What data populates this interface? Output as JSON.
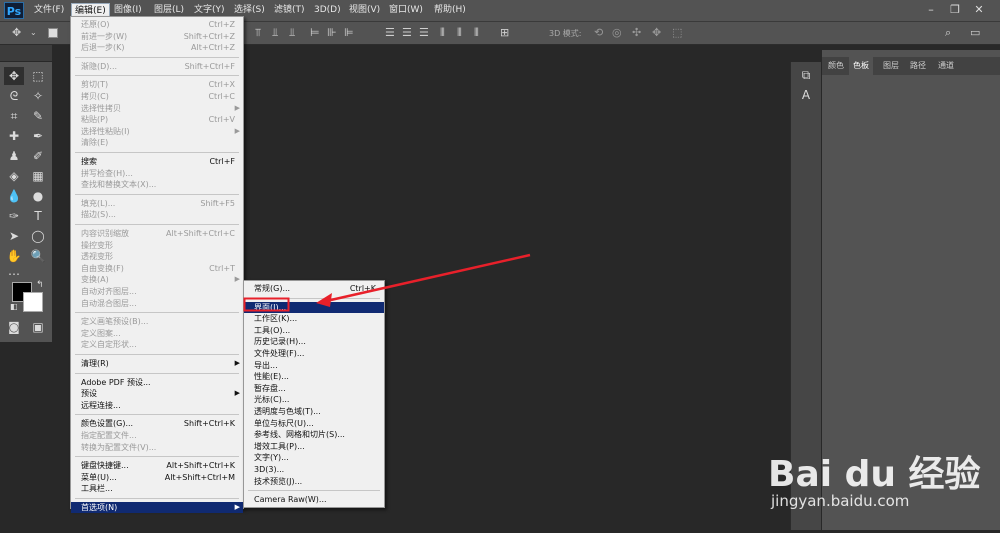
{
  "app": {
    "logo": "Ps"
  },
  "menubar": {
    "items": [
      "文件(F)",
      "编辑(E)",
      "图像(I)",
      "图层(L)",
      "文字(Y)",
      "选择(S)",
      "滤镜(T)",
      "3D(D)",
      "视图(V)",
      "窗口(W)",
      "帮助(H)"
    ],
    "active_index": 1
  },
  "options_bar": {
    "mode_label": "3D 模式:"
  },
  "panels": {
    "tabs": [
      "颜色",
      "色板",
      "图层",
      "路径",
      "通道"
    ],
    "active_tab": "色板"
  },
  "edit_menu": {
    "groups": [
      [
        {
          "label": "还原(O)",
          "shortcut": "Ctrl+Z",
          "disabled": true
        },
        {
          "label": "前进一步(W)",
          "shortcut": "Shift+Ctrl+Z",
          "disabled": true
        },
        {
          "label": "后退一步(K)",
          "shortcut": "Alt+Ctrl+Z",
          "disabled": true
        }
      ],
      [
        {
          "label": "渐隐(D)...",
          "shortcut": "Shift+Ctrl+F",
          "disabled": true
        }
      ],
      [
        {
          "label": "剪切(T)",
          "shortcut": "Ctrl+X",
          "disabled": true
        },
        {
          "label": "拷贝(C)",
          "shortcut": "Ctrl+C",
          "disabled": true
        },
        {
          "label": "选择性拷贝",
          "shortcut": "",
          "disabled": true,
          "submenu": true
        },
        {
          "label": "粘贴(P)",
          "shortcut": "Ctrl+V",
          "disabled": true
        },
        {
          "label": "选择性粘贴(I)",
          "shortcut": "",
          "disabled": true,
          "submenu": true
        },
        {
          "label": "清除(E)",
          "shortcut": "",
          "disabled": true
        }
      ],
      [
        {
          "label": "搜索",
          "shortcut": "Ctrl+F",
          "disabled": false
        },
        {
          "label": "拼写检查(H)...",
          "shortcut": "",
          "disabled": true
        },
        {
          "label": "查找和替换文本(X)...",
          "shortcut": "",
          "disabled": true
        }
      ],
      [
        {
          "label": "填充(L)...",
          "shortcut": "Shift+F5",
          "disabled": true
        },
        {
          "label": "描边(S)...",
          "shortcut": "",
          "disabled": true
        }
      ],
      [
        {
          "label": "内容识别缩放",
          "shortcut": "Alt+Shift+Ctrl+C",
          "disabled": true
        },
        {
          "label": "操控变形",
          "shortcut": "",
          "disabled": true
        },
        {
          "label": "透视变形",
          "shortcut": "",
          "disabled": true
        },
        {
          "label": "自由变换(F)",
          "shortcut": "Ctrl+T",
          "disabled": true
        },
        {
          "label": "变换(A)",
          "shortcut": "",
          "disabled": true,
          "submenu": true
        },
        {
          "label": "自动对齐图层...",
          "shortcut": "",
          "disabled": true
        },
        {
          "label": "自动混合图层...",
          "shortcut": "",
          "disabled": true
        }
      ],
      [
        {
          "label": "定义画笔预设(B)...",
          "shortcut": "",
          "disabled": true
        },
        {
          "label": "定义图案...",
          "shortcut": "",
          "disabled": true
        },
        {
          "label": "定义自定形状...",
          "shortcut": "",
          "disabled": true
        }
      ],
      [
        {
          "label": "清理(R)",
          "shortcut": "",
          "disabled": false,
          "submenu": true
        }
      ],
      [
        {
          "label": "Adobe PDF 预设...",
          "shortcut": "",
          "disabled": false
        },
        {
          "label": "预设",
          "shortcut": "",
          "disabled": false,
          "submenu": true
        },
        {
          "label": "远程连接...",
          "shortcut": "",
          "disabled": false
        }
      ],
      [
        {
          "label": "颜色设置(G)...",
          "shortcut": "Shift+Ctrl+K",
          "disabled": false
        },
        {
          "label": "指定配置文件...",
          "shortcut": "",
          "disabled": true
        },
        {
          "label": "转换为配置文件(V)...",
          "shortcut": "",
          "disabled": true
        }
      ],
      [
        {
          "label": "键盘快捷键...",
          "shortcut": "Alt+Shift+Ctrl+K",
          "disabled": false
        },
        {
          "label": "菜单(U)...",
          "shortcut": "Alt+Shift+Ctrl+M",
          "disabled": false
        },
        {
          "label": "工具栏...",
          "shortcut": "",
          "disabled": false
        }
      ],
      [
        {
          "label": "首选项(N)",
          "shortcut": "",
          "disabled": false,
          "submenu": true,
          "highlighted": true
        }
      ]
    ]
  },
  "prefs_menu": {
    "groups": [
      [
        {
          "label": "常规(G)...",
          "shortcut": "Ctrl+K"
        }
      ],
      [
        {
          "label": "界面(I)...",
          "shortcut": "",
          "highlighted": true
        },
        {
          "label": "工作区(K)...",
          "shortcut": ""
        },
        {
          "label": "工具(O)...",
          "shortcut": ""
        },
        {
          "label": "历史记录(H)...",
          "shortcut": ""
        },
        {
          "label": "文件处理(F)...",
          "shortcut": ""
        },
        {
          "label": "导出...",
          "shortcut": ""
        },
        {
          "label": "性能(E)...",
          "shortcut": ""
        },
        {
          "label": "暂存盘...",
          "shortcut": ""
        },
        {
          "label": "光标(C)...",
          "shortcut": ""
        },
        {
          "label": "透明度与色域(T)...",
          "shortcut": ""
        },
        {
          "label": "单位与标尺(U)...",
          "shortcut": ""
        },
        {
          "label": "参考线、网格和切片(S)...",
          "shortcut": ""
        },
        {
          "label": "增效工具(P)...",
          "shortcut": ""
        },
        {
          "label": "文字(Y)...",
          "shortcut": ""
        },
        {
          "label": "3D(3)...",
          "shortcut": ""
        },
        {
          "label": "技术预览(J)...",
          "shortcut": ""
        }
      ],
      [
        {
          "label": "Camera Raw(W)...",
          "shortcut": ""
        }
      ]
    ]
  },
  "watermark": {
    "logo": "Bai du 经验",
    "url": "jingyan.baidu.com"
  },
  "colors": {
    "menu_highlight": "#102a72",
    "annotation_red": "#e8202a",
    "menu_bg": "#f0f0f0"
  }
}
